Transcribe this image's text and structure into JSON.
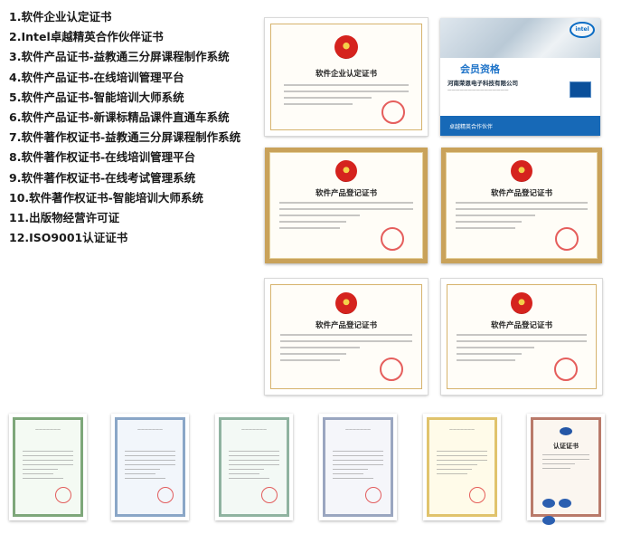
{
  "list": [
    "1.软件企业认定证书",
    "2.Intel卓越精英合作伙伴证书",
    "3.软件产品证书-益教通三分屏课程制作系统",
    "4.软件产品证书-在线培训管理平台",
    "5.软件产品证书-智能培训大师系统",
    "6.软件产品证书-新课标精品课件直通车系统",
    "7.软件著作权证书-益教通三分屏课程制作系统",
    "8.软件著作权证书-在线培训管理平台",
    "9.软件著作权证书-在线考试管理系统",
    "10.软件著作权证书-智能培训大师系统",
    "11.出版物经营许可证",
    "12.ISO9001认证证书"
  ],
  "certs": {
    "enterprise_title": "软件企业认定证书",
    "product_title": "软件产品登记证书",
    "cert_label": "认证证书"
  },
  "intel": {
    "logo": "intel",
    "member_label": "会员资格",
    "company": "河南荣恩电子科技有限公司",
    "program": "卓越精英合作伙伴"
  },
  "colors": {
    "gold_frame": "#c9a25a",
    "seal_red": "#d5231e",
    "intel_blue": "#1769b7"
  }
}
